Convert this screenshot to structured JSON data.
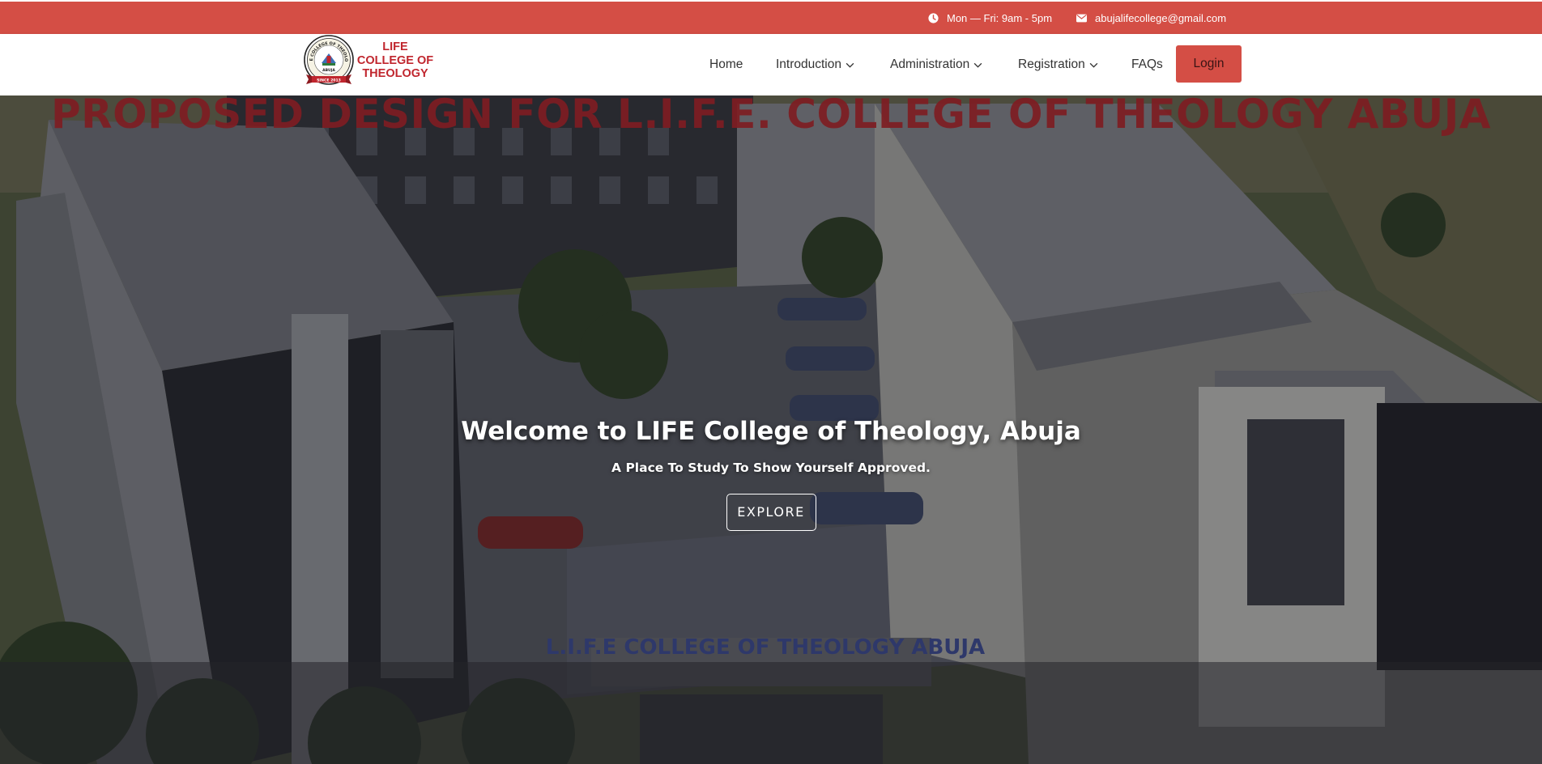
{
  "colors": {
    "accent": "#d44e45",
    "brand_red": "#c0262e",
    "nav_text": "#333333"
  },
  "topbar": {
    "hours": {
      "icon": "clock-icon",
      "text": "Mon — Fri: 9am - 5pm"
    },
    "email": {
      "icon": "envelope-icon",
      "text": "abujalifecollege@gmail.com"
    }
  },
  "header": {
    "logo": {
      "line1": "LIFE",
      "line2": "COLLEGE OF",
      "line3": "THEOLOGY",
      "seal_ring": "LIFE COLLEGE OF THEOLOGY",
      "seal_city": "ABUJA",
      "seal_since": "SINCE 2013"
    },
    "nav": {
      "home": "Home",
      "introduction": "Introduction",
      "administration": "Administration",
      "registration": "Registration",
      "faqs": "FAQs"
    },
    "login_label": "Login"
  },
  "hero": {
    "banner": "PROPOSED DESIGN FOR L.I.F.E. COLLEGE OF THEOLOGY ABUJA",
    "building_sign": "L.I.F.E COLLEGE OF THEOLOGY ABUJA",
    "title": "Welcome to LIFE College of Theology, Abuja",
    "subtitle": "A Place To Study To Show Yourself Approved.",
    "cta_label": "EXPLORE"
  }
}
